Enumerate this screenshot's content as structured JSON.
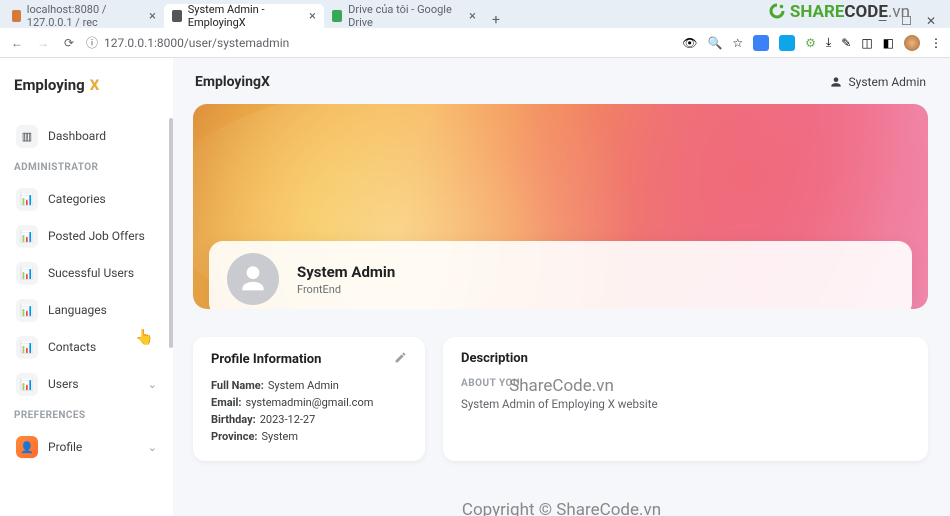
{
  "browser": {
    "tabs": [
      {
        "label": "localhost:8080 / 127.0.0.1 / rec",
        "favicon": "#d57a3a"
      },
      {
        "label": "System Admin - EmployingX",
        "favicon": "#555555",
        "active": true
      },
      {
        "label": "Drive của tôi - Google Drive",
        "favicon": "#3aa757"
      }
    ],
    "url": "127.0.0.1:8000/user/systemadmin"
  },
  "watermark": {
    "brand_a": "SHARE",
    "brand_b": "CODE",
    "brand_c": ".vn",
    "center1": "ShareCode.vn",
    "center2": "Copyright © ShareCode.vn"
  },
  "brand": {
    "name": "Employing",
    "suffix": "X"
  },
  "sidebar": {
    "dashboard": "Dashboard",
    "section_admin": "ADMINISTRATOR",
    "categories": "Categories",
    "posted_job_offers": "Posted Job Offers",
    "successful_users": "Sucessful Users",
    "languages": "Languages",
    "contacts": "Contacts",
    "users": "Users",
    "section_prefs": "PREFERENCES",
    "profile": "Profile"
  },
  "header": {
    "title": "EmployingX",
    "user_label": "System Admin"
  },
  "profile": {
    "name": "System Admin",
    "role": "FrontEnd"
  },
  "info_card": {
    "title": "Profile Information",
    "full_name_label": "Full Name:",
    "full_name_value": "System Admin",
    "email_label": "Email:",
    "email_value": "systemadmin@gmail.com",
    "birthday_label": "Birthday:",
    "birthday_value": "2023-12-27",
    "province_label": "Province:",
    "province_value": "System"
  },
  "desc_card": {
    "title": "Description",
    "subhead": "ABOUT YOU",
    "body": "System Admin of Employing X website"
  }
}
